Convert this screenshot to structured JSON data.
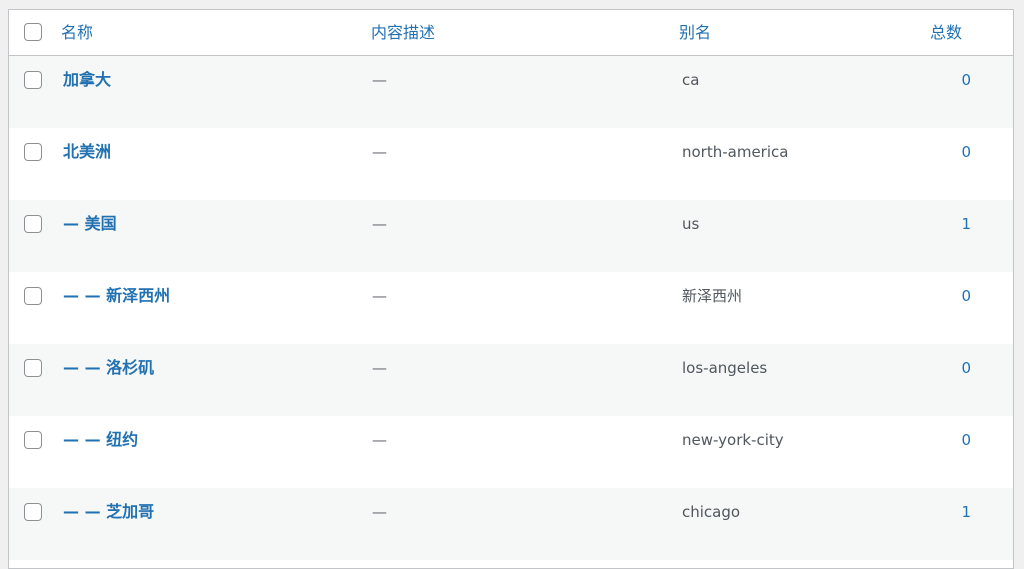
{
  "columns": {
    "name": "名称",
    "description": "内容描述",
    "slug": "别名",
    "count": "总数"
  },
  "rows": [
    {
      "name": "加拿大",
      "description": "—",
      "slug": "ca",
      "count": "0"
    },
    {
      "name": "北美洲",
      "description": "—",
      "slug": "north-america",
      "count": "0"
    },
    {
      "name": "— 美国",
      "description": "—",
      "slug": "us",
      "count": "1"
    },
    {
      "name": "— — 新泽西州",
      "description": "—",
      "slug": "新泽西州",
      "count": "0"
    },
    {
      "name": "— — 洛杉矶",
      "description": "—",
      "slug": "los-angeles",
      "count": "0"
    },
    {
      "name": "— — 纽约",
      "description": "—",
      "slug": "new-york-city",
      "count": "0"
    },
    {
      "name": "— — 芝加哥",
      "description": "—",
      "slug": "chicago",
      "count": "1"
    }
  ],
  "colors": {
    "link": "#2271b1",
    "alt_row": "#f6f7f7",
    "border": "#c3c4c7"
  }
}
